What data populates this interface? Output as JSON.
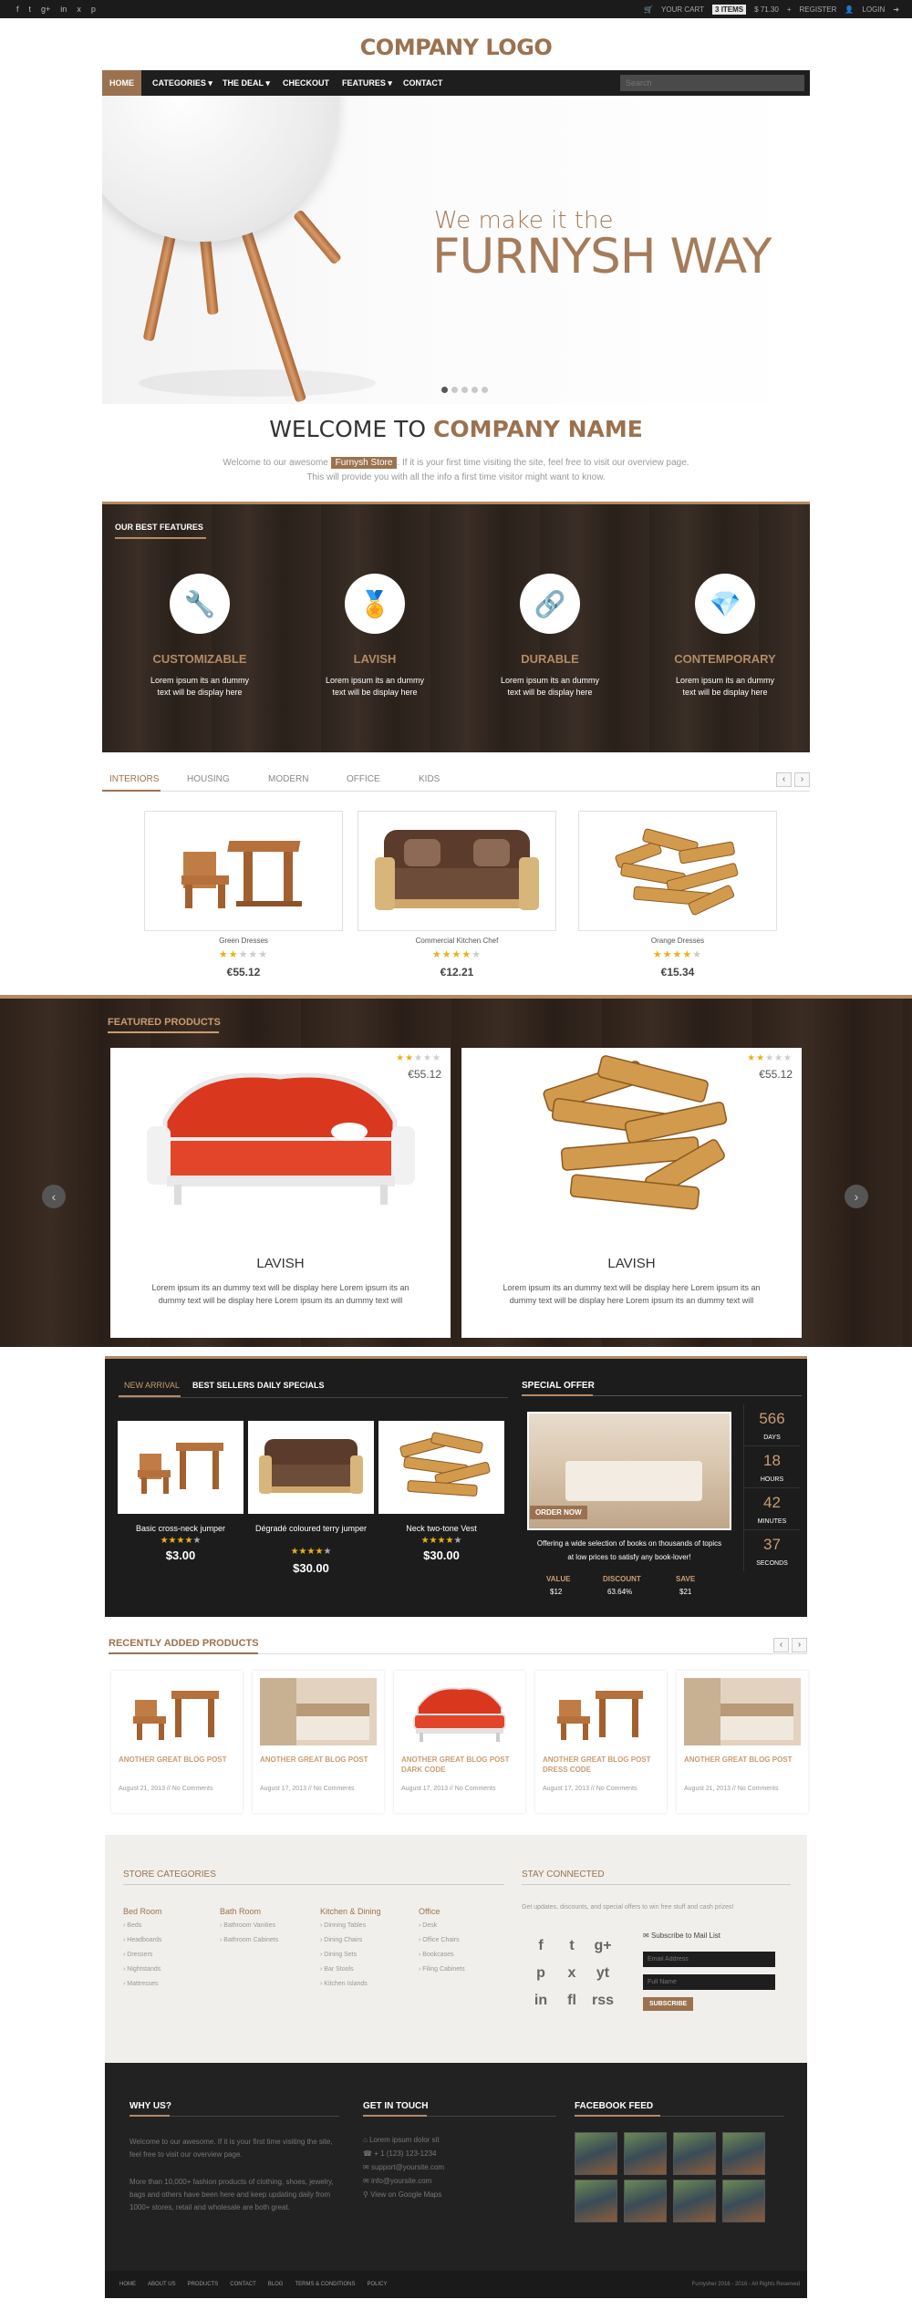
{
  "topbar": {
    "socials": [
      "f",
      "t",
      "g+",
      "in",
      "x",
      "p"
    ],
    "your_cart": "YOUR CART",
    "cart_badge": "3 ITEMS",
    "cart_total": "$ 71.30",
    "register": "REGISTER",
    "login": "LOGIN"
  },
  "logo": "COMPANY LOGO",
  "nav": {
    "items": [
      "HOME",
      "CATEGORIES",
      "THE DEAL",
      "CHECKOUT",
      "FEATURES",
      "CONTACT"
    ],
    "search_placeholder": "Search"
  },
  "hero": {
    "line1": "We make it the",
    "line2": "FURNYSH WAY"
  },
  "welcome": {
    "title_a": "WELCOME TO",
    "title_b": "COMPANY NAME",
    "text_a": "Welcome to our awesome",
    "store": "Furnysh Store",
    "text_b": ". If it is your first time visiting the site, feel free to visit our overview page.",
    "text_c": "This will provide you with all the info a first time visitor might want to know."
  },
  "features": {
    "heading": "OUR BEST FEATURES",
    "items": [
      {
        "title": "CUSTOMIZABLE",
        "text": "Lorem ipsum its an dummy text will be display here"
      },
      {
        "title": "LAVISH",
        "text": "Lorem ipsum its an dummy text will be display here"
      },
      {
        "title": "DURABLE",
        "text": "Lorem ipsum its an dummy text will be display here"
      },
      {
        "title": "CONTEMPORARY",
        "text": "Lorem ipsum its an dummy text will be display here"
      }
    ]
  },
  "tabs": [
    "INTERIORS",
    "HOUSING",
    "MODERN",
    "OFFICE",
    "KIDS"
  ],
  "products": [
    {
      "name": "Green Dresses",
      "price": "€55.12",
      "rating": 2
    },
    {
      "name": "Commercial Kitchen Chef",
      "price": "€12.21",
      "rating": 4
    },
    {
      "name": "Orange Dresses",
      "price": "€15.34",
      "rating": 4
    }
  ],
  "featured": {
    "title": "FEATURED PRODUCTS",
    "cards": [
      {
        "name": "LAVISH",
        "price": "€55.12",
        "rating": 2,
        "text": "Lorem ipsum its an dummy text will be display here Lorem ipsum its an dummy text will be display here Lorem ipsum its an dummy text will"
      },
      {
        "name": "LAVISH",
        "price": "€55.12",
        "rating": 2,
        "text": "Lorem ipsum its an dummy text will be display here Lorem ipsum its an dummy text will be display here Lorem ipsum its an dummy text will"
      }
    ]
  },
  "arrivals": {
    "tabs": [
      "NEW ARRIVAL",
      "BEST SELLERS",
      "DAILY SPECIALS"
    ],
    "items": [
      {
        "name": "Basic cross-neck jumper",
        "price": "$3.00",
        "rating": 4
      },
      {
        "name": "Dégradé coloured terry jumper",
        "price": "$30.00",
        "rating": 4
      },
      {
        "name": "Neck two-tone Vest",
        "price": "$30.00",
        "rating": 4
      }
    ],
    "special_title": "SPECIAL OFFER",
    "order_now": "ORDER NOW",
    "special_desc_a": "Offering a wide selection of books on thousands of topics",
    "special_desc_b": "at low prices to satisfy any book-lover!",
    "stats": [
      {
        "label": "VALUE",
        "value": "$12"
      },
      {
        "label": "DISCOUNT",
        "value": "63.64%"
      },
      {
        "label": "SAVE",
        "value": "$21"
      }
    ],
    "countdown": [
      {
        "num": "566",
        "label": "DAYS"
      },
      {
        "num": "18",
        "label": "HOURS"
      },
      {
        "num": "42",
        "label": "MINUTES"
      },
      {
        "num": "37",
        "label": "SECONDS"
      }
    ]
  },
  "recent": {
    "title": "RECENTLY ADDED PRODUCTS",
    "cards": [
      {
        "title": "ANOTHER GREAT BLOG POST",
        "meta": "August 21, 2013 // No Comments"
      },
      {
        "title": "ANOTHER GREAT BLOG POST",
        "meta": "August 17, 2013 // No Comments"
      },
      {
        "title": "ANOTHER GREAT BLOG POST DARK CODE",
        "meta": "August 17, 2013 // No Comments"
      },
      {
        "title": "ANOTHER GREAT BLOG POST DRESS CODE",
        "meta": "August 17, 2013 // No Comments"
      },
      {
        "title": "ANOTHER GREAT BLOG POST",
        "meta": "August 21, 2013 // No Comments"
      }
    ]
  },
  "store_categories": {
    "title": "STORE CATEGORIES",
    "columns": [
      {
        "heading": "Bed Room",
        "items": [
          "Beds",
          "Headboards",
          "Dressers",
          "Nightstands",
          "Mattresses"
        ]
      },
      {
        "heading": "Bath Room",
        "items": [
          "Bathroom Vanities",
          "Bathroom Cabinets"
        ]
      },
      {
        "heading": "Kitchen & Dining",
        "items": [
          "Dinning Tables",
          "Dining Chairs",
          "Dining Sets",
          "Bar Stools",
          "Kitchen Islands"
        ]
      },
      {
        "heading": "Office",
        "items": [
          "Desk",
          "Office Chairs",
          "Bookcases",
          "Filing Cabinets"
        ]
      }
    ]
  },
  "stay_connected": {
    "title": "STAY CONNECTED",
    "text": "Get updates, discounts, and special offers to win free stuff and cash prizes!",
    "social_icons": [
      "f",
      "t",
      "g+",
      "p",
      "x",
      "yt",
      "in",
      "fl",
      "rss"
    ],
    "mail_label": "Subscribe to Mail List",
    "email_placeholder": "Email Address",
    "name_placeholder": "Full Name",
    "subscribe": "SUBSCRIBE"
  },
  "why_us": {
    "title": "WHY US?",
    "p1": "Welcome to our awesome. If it is your first time visiting the site, feel free to visit our overview page.",
    "p2": "More than 10,000+ fashion products of clothing, shoes, jewelry, bags and others have been here and keep updating daily from 1000+ stores, retail and wholesale are both great."
  },
  "get_in_touch": {
    "title": "GET IN TOUCH",
    "lines": [
      "Lorem ipsum dolor sit",
      "+ 1 (123) 123-1234",
      "support@yoursite.com",
      "info@yoursite.com",
      "View on Google Maps"
    ]
  },
  "facebook": {
    "title": "FACEBOOK FEED"
  },
  "bottom": {
    "links": [
      "HOME",
      "ABOUT US",
      "PRODUCTS",
      "CONTACT",
      "BLOG",
      "TERMS & CONDITIONS",
      "POLICY"
    ],
    "copyright": "Furnysher 2016 - 2016 - All Rights Reserved"
  }
}
